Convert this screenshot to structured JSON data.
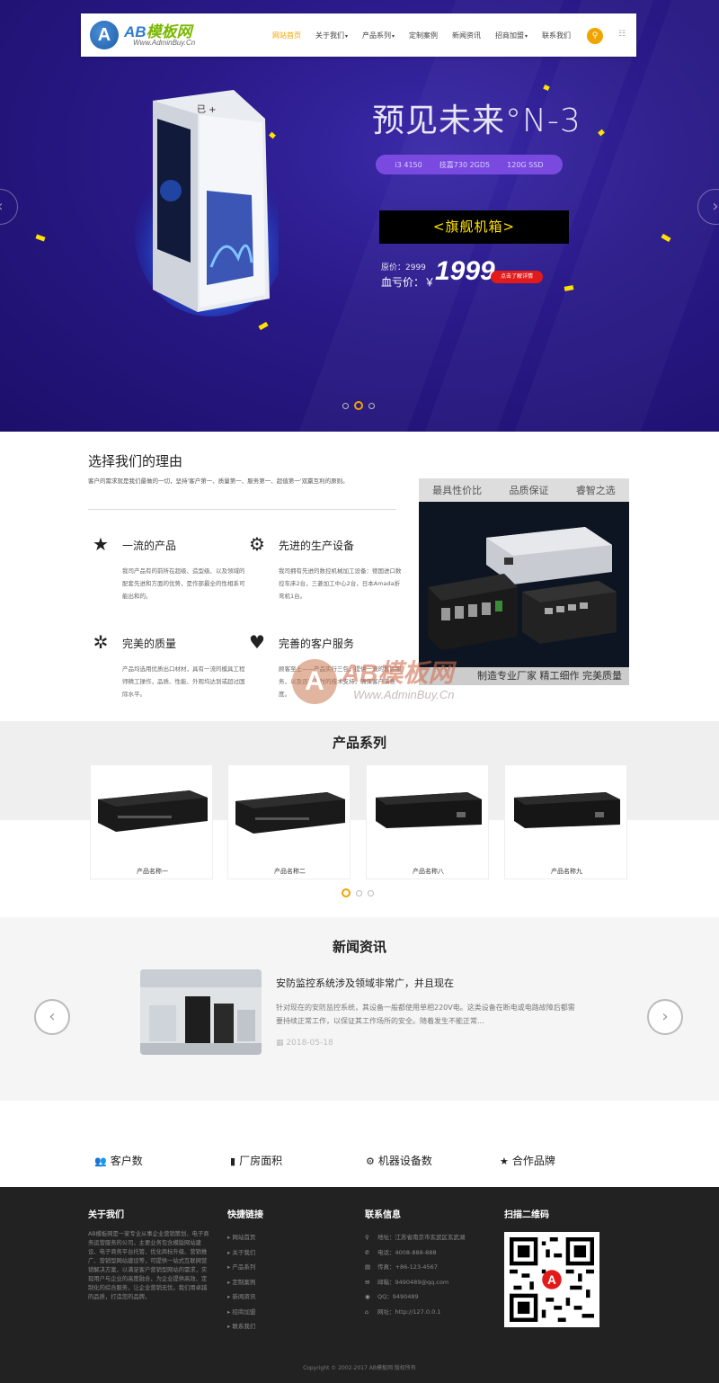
{
  "nav": {
    "logo_letter": "A",
    "logo_en": "AB",
    "logo_cn": "模板网",
    "logo_sub": "Www.AdminBuy.Cn",
    "items": [
      {
        "label": "网站首页",
        "caret": ""
      },
      {
        "label": "关于我们",
        "caret": "▾"
      },
      {
        "label": "产品系列",
        "caret": "▾"
      },
      {
        "label": "定制案例",
        "caret": ""
      },
      {
        "label": "新闻资讯",
        "caret": ""
      },
      {
        "label": "招商加盟",
        "caret": "▾"
      },
      {
        "label": "联系我们",
        "caret": ""
      }
    ],
    "search_icon": "search-icon",
    "lang_icon": "lang-icon"
  },
  "hero": {
    "title": "预见未来°N-3",
    "specs": [
      "i3 4150",
      "技嘉730 2GD5",
      "120G SSD"
    ],
    "flag": "<旗舰机箱>",
    "orig_price": "原价：2999",
    "blood_price_label": "血亏价：￥",
    "price": "1999",
    "buy_label": "点击了解详情",
    "case_label": "已 +",
    "prev": "‹",
    "next": "›",
    "active_slide": 2,
    "slide_count": 3
  },
  "why": {
    "title": "选择我们的理由",
    "subtitle": "客户的需求就是我们最做的一切，坚持'客户第一、质量第一、服务第一、超值第一'双赢互利的原则。",
    "features": [
      {
        "title": "一流的产品",
        "text": "我司产品有的前所在超级、造型级、以及领域的配套先进和方面的优势，是作部最全的性相系可能出和的。",
        "icon": "star-icon",
        "glyph": "★"
      },
      {
        "title": "先进的生产设备",
        "text": "我司拥有先进的数控机械加工设备：德国进口数控车床2台，三菱加工中心2台，日本Amada折弯机1台。",
        "icon": "gears-icon",
        "glyph": "⚙"
      },
      {
        "title": "完美的质量",
        "text": "产品均选用优质出口材材，具有一流的模具工程师精工操作，品质、性能、外观均达到或超过国际水平。",
        "icon": "quality-badge-icon",
        "glyph": "✲"
      },
      {
        "title": "完善的客户服务",
        "text": "顾客至上——产品实行三包，提供一流的售后服务，以及迅速及时的技术支持，确保客户满意度。",
        "icon": "heart-icon",
        "glyph": "♥"
      }
    ],
    "tabs": [
      "最具性价比",
      "品质保证",
      "睿智之选"
    ],
    "caption": "制造专业厂家   精工细作 完美质量",
    "watermark_letter": "A",
    "watermark_text": "AB模板网",
    "watermark_sub": "Www.AdminBuy.Cn"
  },
  "products": {
    "title": "产品系列",
    "items": [
      "产品名称一",
      "产品名称二",
      "产品名称八",
      "产品名称九"
    ],
    "active_dot": 1,
    "dot_count": 3
  },
  "news": {
    "title": "新闻资讯",
    "headline": "安防监控系统涉及领域非常广，并且现在",
    "body": "针对现在的安防监控系统，其设备一般都使用单相220V电。这类设备在断电或电路故障后都需要持续正常工作，以保证其工作场所的安全。随着发生不能正常...",
    "date": "2018-05-18",
    "prev": "‹",
    "next": "›"
  },
  "stats": [
    {
      "label": "客户数",
      "icon": "users-icon",
      "glyph": "👥"
    },
    {
      "label": "厂房面积",
      "icon": "building-icon",
      "glyph": "▮"
    },
    {
      "label": "机器设备数",
      "icon": "cogs-icon",
      "glyph": "⚙"
    },
    {
      "label": "合作品牌",
      "icon": "star-icon",
      "glyph": "★"
    }
  ],
  "footer": {
    "about_title": "关于我们",
    "about_text": "AB模板网是一家专业从事企业营销策划、电子商务运营服务的公司，主要业务包含模版网站建设、电子商务平台托管、优化商标升级、营销推广、营销型网站建设等，可提供一站式互联网营销解决方案，以满足客户营销型网站的需求，实现用户与企业的高度融合，为企业提供高效、定制化的综合服务，让企业营销无忧。我们用卓越的品质，打造您的品牌。",
    "links_title": "快捷链接",
    "links": [
      "网站首页",
      "关于我们",
      "产品系列",
      "定制案例",
      "新闻资讯",
      "招商加盟",
      "联系我们"
    ],
    "contact_title": "联系信息",
    "contact": [
      {
        "icon": "location-icon",
        "glyph": "⚲",
        "text": "地址：江苏省南京市玄武区玄武湖"
      },
      {
        "icon": "phone-icon",
        "glyph": "✆",
        "text": "电话：4008-888-888"
      },
      {
        "icon": "fax-icon",
        "glyph": "▤",
        "text": "传真：+86-123-4567"
      },
      {
        "icon": "mail-icon",
        "glyph": "✉",
        "text": "邮箱：9490489@qq.com"
      },
      {
        "icon": "qq-icon",
        "glyph": "◉",
        "text": "QQ：9490489"
      },
      {
        "icon": "home-icon",
        "glyph": "⌂",
        "text": "网址：http://127.0.0.1"
      }
    ],
    "qr_title": "扫描二维码",
    "qr_letter": "A",
    "copyright": "Copyright © 2002-2017 AB模板网 版权所有"
  },
  "colors": {
    "accent": "#f0a400",
    "hero_bg": "#2a1a8a",
    "footer_bg": "#222222",
    "buy_red": "#e31a1a"
  }
}
